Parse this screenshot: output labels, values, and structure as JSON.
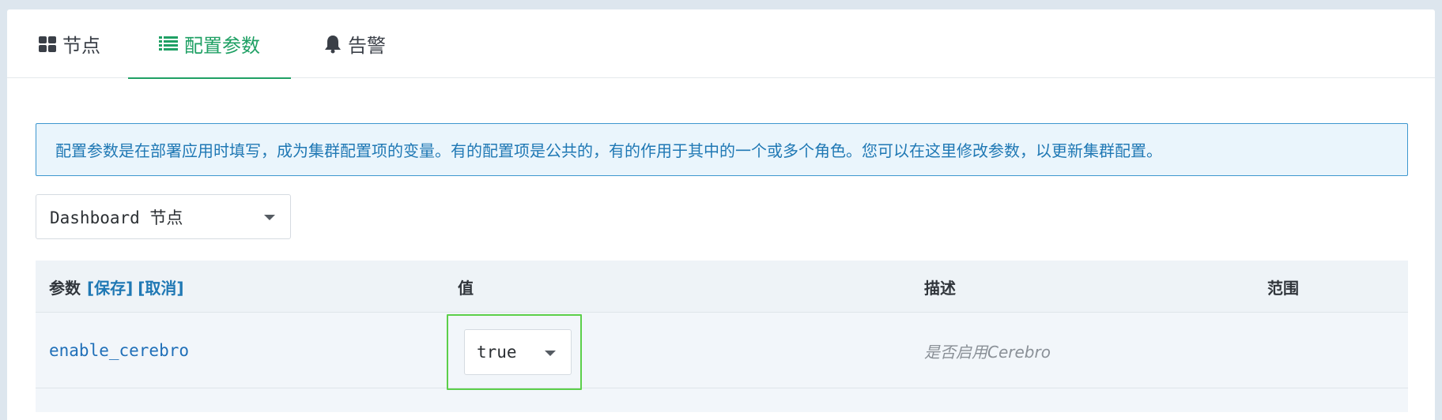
{
  "tabs": [
    {
      "label": "节点",
      "icon": "grid-icon",
      "active": false
    },
    {
      "label": "配置参数",
      "icon": "list-icon",
      "active": true
    },
    {
      "label": "告警",
      "icon": "bell-icon",
      "active": false
    }
  ],
  "info_text": "配置参数是在部署应用时填写，成为集群配置项的变量。有的配置项是公共的，有的作用于其中的一个或多个角色。您可以在这里修改参数，以更新集群配置。",
  "role_select": {
    "value": "Dashboard 节点"
  },
  "table": {
    "headers": {
      "param": "参数",
      "save": "[保存]",
      "cancel": "[取消]",
      "value": "值",
      "desc": "描述",
      "scope": "范围"
    },
    "rows": [
      {
        "param": "enable_cerebro",
        "value": "true",
        "desc": "是否启用Cerebro",
        "scope": ""
      }
    ]
  },
  "colors": {
    "accent": "#1fa064",
    "link": "#1f78b4",
    "highlight": "#5ccf4a"
  }
}
